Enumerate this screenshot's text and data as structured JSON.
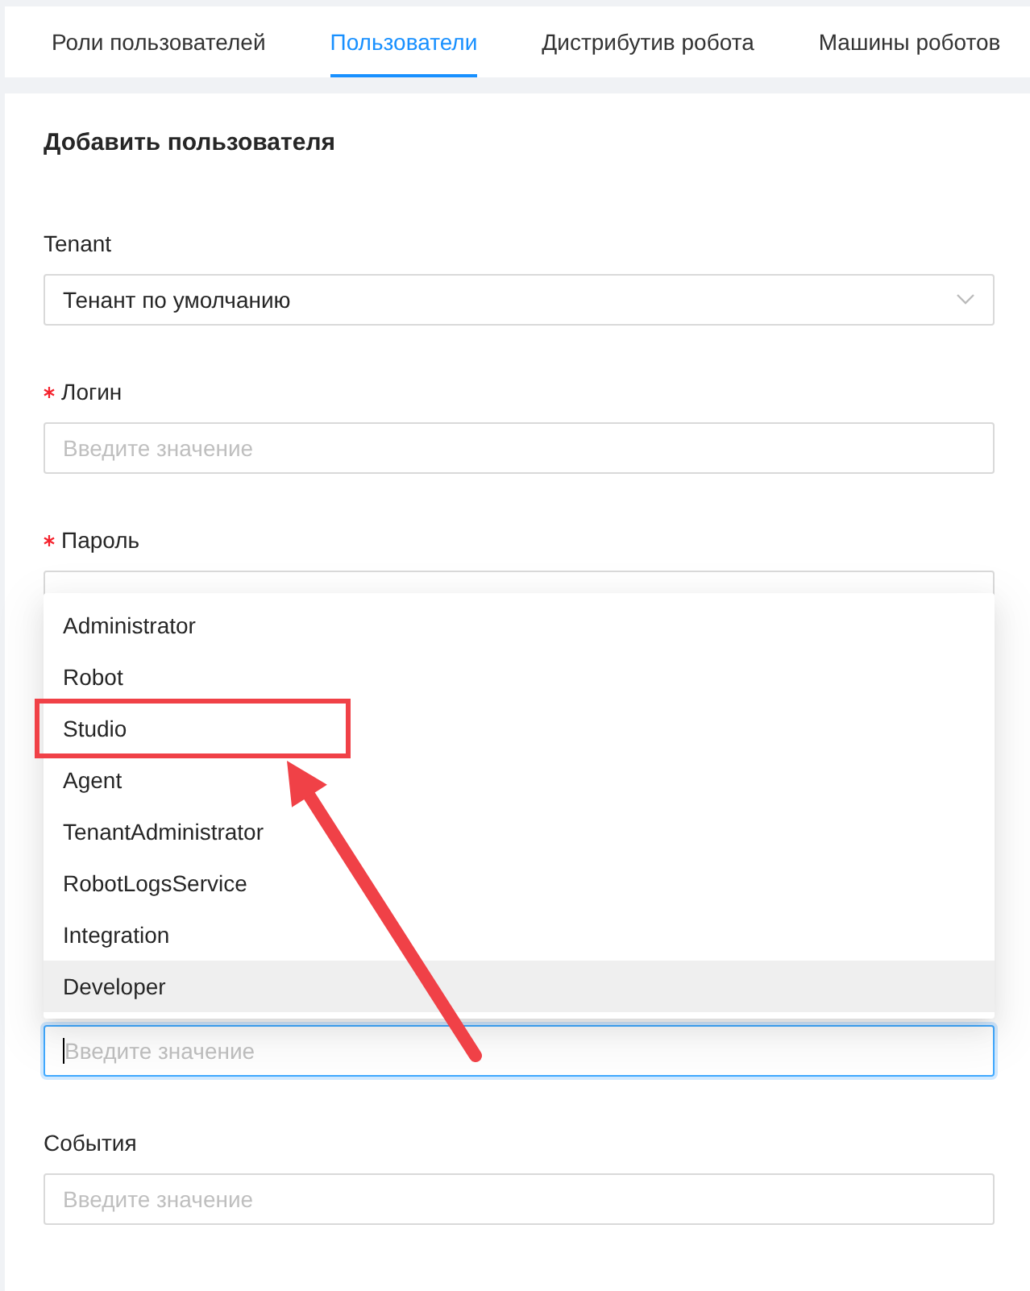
{
  "tabs": [
    {
      "label": "Роли пользователей",
      "selected": false
    },
    {
      "label": "Пользователи",
      "selected": true
    },
    {
      "label": "Дистрибутив робота",
      "selected": false
    },
    {
      "label": "Машины роботов",
      "selected": false
    }
  ],
  "form": {
    "title": "Добавить пользователя",
    "fields": [
      {
        "kind": "select",
        "label": "Tenant",
        "required": false,
        "value": "Тенант по умолчанию"
      },
      {
        "kind": "input",
        "label": "Логин",
        "required": true,
        "placeholder": "Введите значение"
      },
      {
        "kind": "password",
        "label": "Пароль",
        "required": true
      },
      {
        "kind": "input",
        "placeholder": "Введите значение",
        "focused": true
      },
      {
        "kind": "input",
        "label": "События",
        "required": false,
        "placeholder": "Введите значение"
      }
    ]
  },
  "dropdown": {
    "options": [
      {
        "label": "Administrator",
        "hovered": false,
        "marked": false
      },
      {
        "label": "Robot",
        "hovered": false,
        "marked": false
      },
      {
        "label": "Studio",
        "hovered": false,
        "marked": true
      },
      {
        "label": "Agent",
        "hovered": false,
        "marked": false
      },
      {
        "label": "TenantAdministrator",
        "hovered": false,
        "marked": false
      },
      {
        "label": "RobotLogsService",
        "hovered": false,
        "marked": false
      },
      {
        "label": "Integration",
        "hovered": false,
        "marked": false
      },
      {
        "label": "Developer",
        "hovered": true,
        "marked": false
      }
    ]
  }
}
